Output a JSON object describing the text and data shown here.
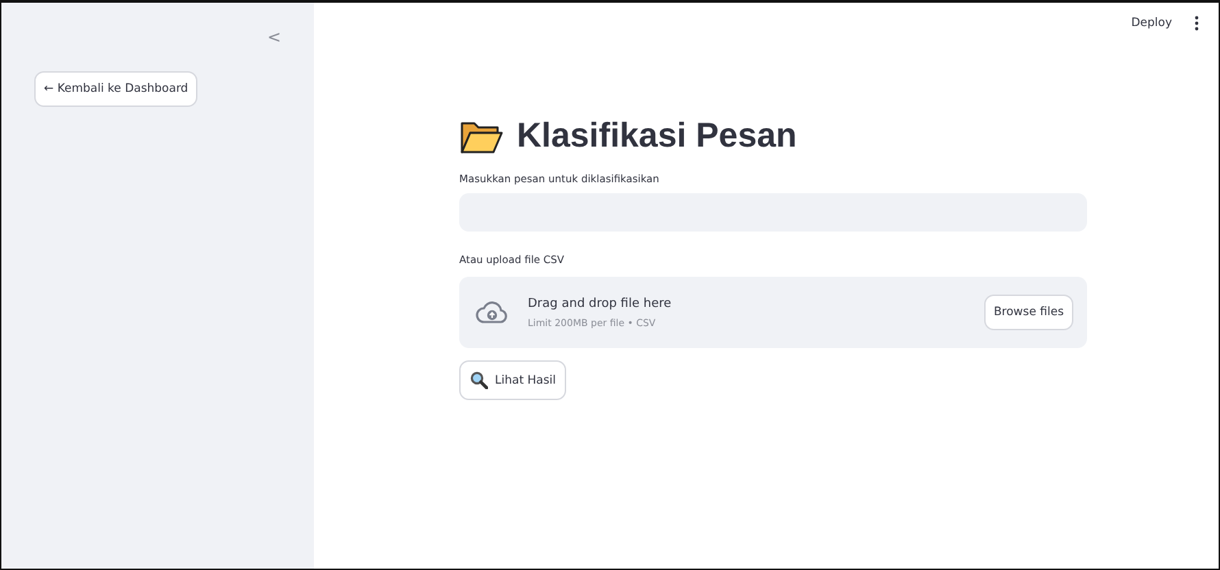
{
  "sidebar": {
    "collapse_icon": "<",
    "back_button": "← Kembali ke Dashboard"
  },
  "header": {
    "deploy": "Deploy"
  },
  "title": "Klasifikasi Pesan",
  "message_input": {
    "label": "Masukkan pesan untuk diklasifikasikan"
  },
  "file_upload": {
    "label": "Atau upload file CSV",
    "drop_text": "Drag and drop file here",
    "limit_text": "Limit 200MB per file • CSV",
    "browse_button": "Browse files"
  },
  "submit_button": "Lihat Hasil"
}
